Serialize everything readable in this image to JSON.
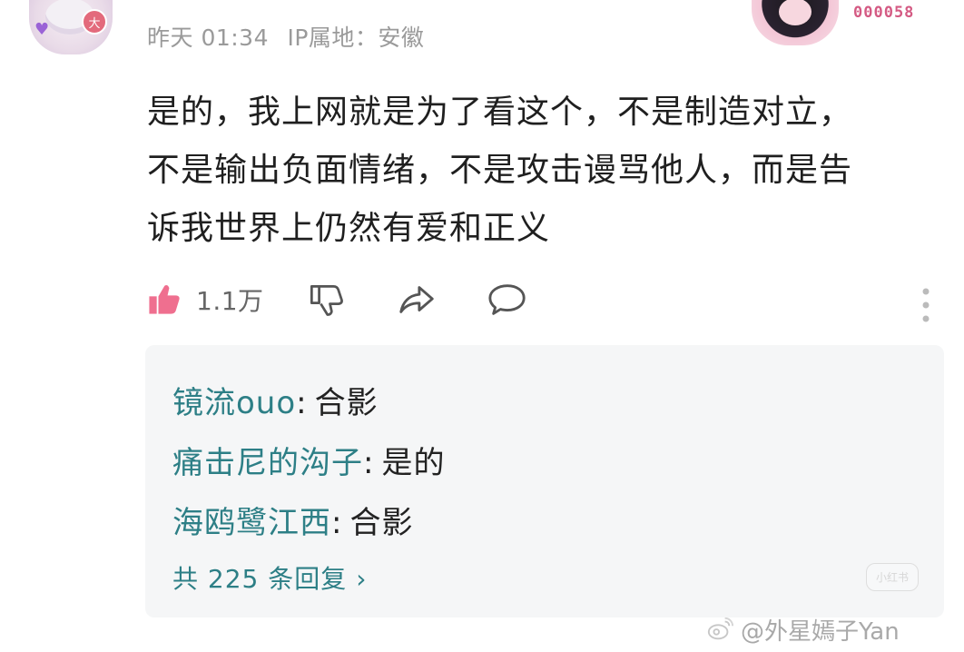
{
  "comment": {
    "time_label": "昨天 01:34",
    "ip_label": "IP属地：安徽",
    "badge_number": "000058",
    "avatar_badge": "大",
    "text": "是的，我上网就是为了看这个，不是制造对立，\n不是输出负面情绪，不是攻击谩骂他人，而是告\n诉我世界上仍然有爱和正义"
  },
  "actions": {
    "like_count": "1.1万"
  },
  "replies": [
    {
      "name": "镜流ouo",
      "separator": ":",
      "content": "合影"
    },
    {
      "name": "痛击尼的沟子",
      "separator": ":",
      "content": "是的"
    },
    {
      "name": "海鸥鹭江西",
      "separator": ":",
      "content": "合影"
    }
  ],
  "more_replies": {
    "label": "共 225 条回复",
    "chevron": "›"
  },
  "watermark": {
    "small_label": "小红书",
    "handle": "@外星嫣子Yan"
  },
  "icons": {
    "like": "thumbs-up-icon",
    "dislike": "thumbs-down-icon",
    "share": "share-icon",
    "comment": "comment-icon",
    "more": "more-vertical-icon",
    "weibo": "weibo-icon"
  },
  "colors": {
    "accent_pink": "#ef6f8f",
    "name_teal": "#2d7f86",
    "meta_gray": "#9a9a9a",
    "reply_bg": "#f5f6f7"
  }
}
